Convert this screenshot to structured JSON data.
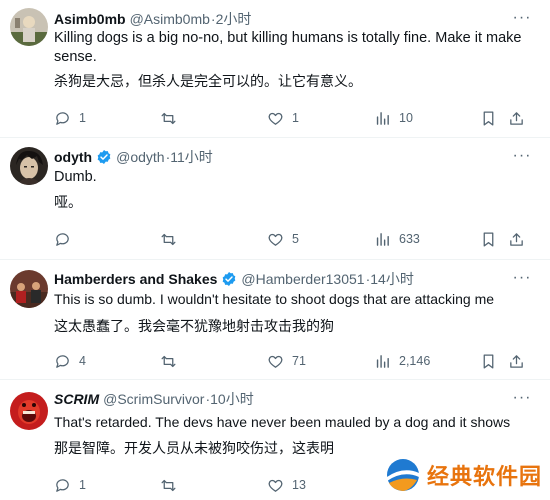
{
  "colors": {
    "text": "#0f1419",
    "muted": "#536471",
    "verified": "#1d9bf0",
    "divider": "#eff3f4",
    "watermark": "#e8740e"
  },
  "tweets": [
    {
      "name": "Asimb0mb",
      "handle": "@Asimb0mb",
      "dot": "·",
      "time": "2小时",
      "verified": false,
      "text1": "Killing dogs is a big no-no, but killing humans is totally fine. Make it make sense.",
      "text2": "杀狗是大忌，但杀人是完全可以的。让它有意义。",
      "replies": "1",
      "retweets": "",
      "likes": "1",
      "views": "10"
    },
    {
      "name": "odyth",
      "handle": "@odyth",
      "dot": "·",
      "time": "11小时",
      "verified": true,
      "text1": "Dumb.",
      "text2": "哑。",
      "replies": "",
      "retweets": "",
      "likes": "5",
      "views": "633"
    },
    {
      "name": "Hamberders and Shakes",
      "handle": "@Hamberder13051",
      "dot": "·",
      "time": "14小时",
      "verified": true,
      "text1": "This is so dumb. I wouldn't hesitate to shoot dogs that are attacking me",
      "text2": "这太愚蠢了。我会毫不犹豫地射击攻击我的狗",
      "replies": "4",
      "retweets": "",
      "likes": "71",
      "views": "2,146"
    },
    {
      "name": "SCRIM",
      "handle": "@ScrimSurvivor",
      "dot": "·",
      "time": "10小时",
      "verified": false,
      "text1": "That's retarded. The devs have never been mauled by a dog and it shows",
      "text2": "那是智障。开发人员从未被狗咬伤过，这表明",
      "replies": "1",
      "retweets": "",
      "likes": "13",
      "views": ""
    }
  ],
  "watermark": {
    "text": "经典软件园",
    "icon": "globe-logo-icon"
  }
}
